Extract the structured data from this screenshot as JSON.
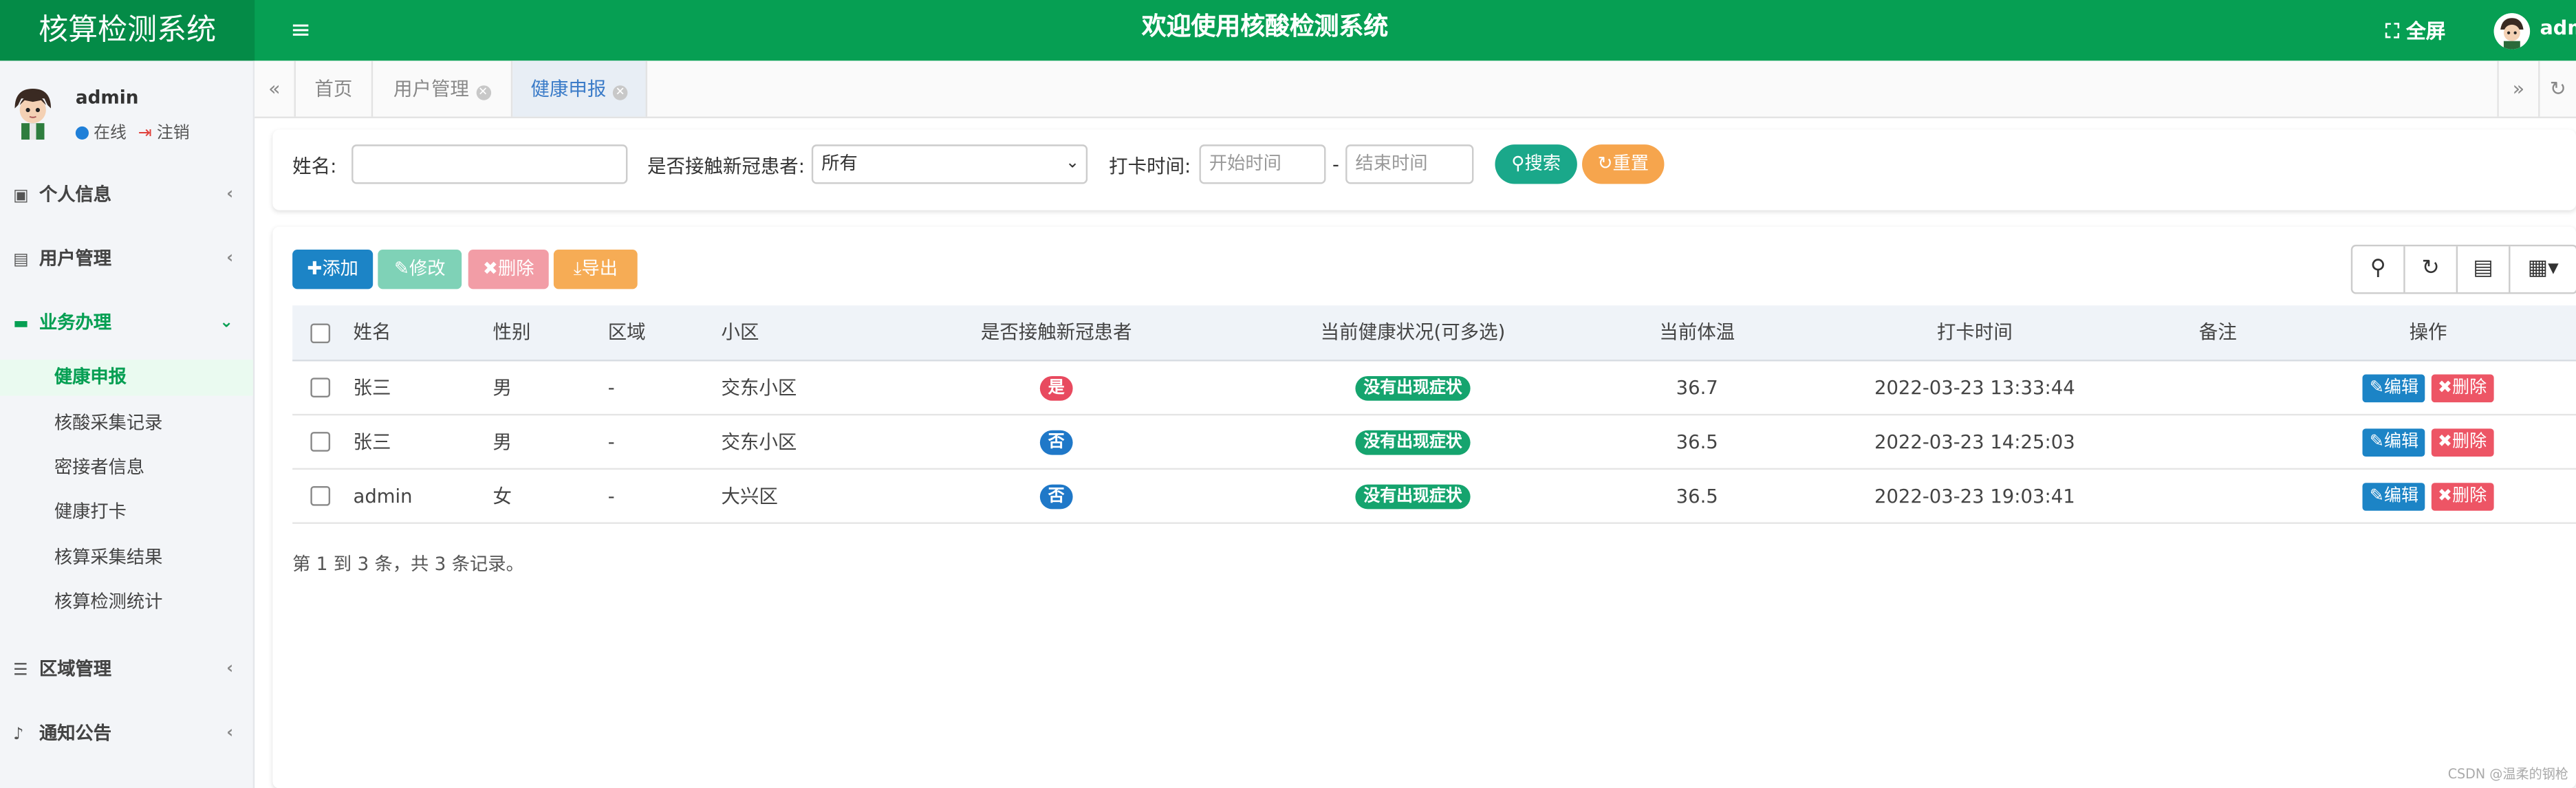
{
  "app": {
    "logo_text": "核算检测系统",
    "welcome_text": "欢迎使用核酸检测系统",
    "fullscreen_label": "全屏",
    "top_user": "admin",
    "menu_icon": "hamburger-icon",
    "colors": {
      "brand": "#069f53",
      "brand_dark": "#048b47"
    }
  },
  "sidebar": {
    "username": "admin",
    "status_online": "在线",
    "logout_label": "注销",
    "groups": [
      {
        "label": "个人信息",
        "icon": "id-card-icon"
      },
      {
        "label": "用户管理",
        "icon": "address-card-icon"
      },
      {
        "label": "业务办理",
        "icon": "coffee-cup-icon"
      },
      {
        "label": "区域管理",
        "icon": "server-icon"
      },
      {
        "label": "通知公告",
        "icon": "bell-icon"
      }
    ],
    "sub_items": [
      {
        "label": "健康申报"
      },
      {
        "label": "核酸采集记录"
      },
      {
        "label": "密接者信息"
      },
      {
        "label": "健康打卡"
      },
      {
        "label": "核算采集结果"
      },
      {
        "label": "核算检测统计"
      }
    ]
  },
  "tabs": [
    {
      "label": "首页"
    },
    {
      "label": "用户管理"
    },
    {
      "label": "健康申报"
    }
  ],
  "search": {
    "name_label": "姓名:",
    "name_value": "",
    "contact_label": "是否接触新冠患者:",
    "contact_value": "所有",
    "time_label": "打卡时间:",
    "start_placeholder": "开始时间",
    "separator": "-",
    "end_placeholder": "结束时间",
    "search_button": "搜索",
    "reset_button": "重置"
  },
  "toolbar": {
    "add": "添加",
    "edit": "修改",
    "delete": "删除",
    "export": "导出",
    "tools": [
      "search-icon",
      "refresh-icon",
      "columns-icon",
      "grid-icon"
    ]
  },
  "table": {
    "headers": [
      "姓名",
      "性别",
      "区域",
      "小区",
      "是否接触新冠患者",
      "当前健康状况(可多选)",
      "当前体温",
      "打卡时间",
      "备注",
      "操作"
    ],
    "rows": [
      {
        "name": "张三",
        "gender": "男",
        "area": "-",
        "community": "交东小区",
        "contact": "是",
        "health": "没有出现症状",
        "temp": "36.7",
        "time": "2022-03-23 13:33:44",
        "remark": ""
      },
      {
        "name": "张三",
        "gender": "男",
        "area": "-",
        "community": "交东小区",
        "contact": "否",
        "health": "没有出现症状",
        "temp": "36.5",
        "time": "2022-03-23 14:25:03",
        "remark": ""
      },
      {
        "name": "admin",
        "gender": "女",
        "area": "-",
        "community": "大兴区",
        "contact": "否",
        "health": "没有出现症状",
        "temp": "36.5",
        "time": "2022-03-23 19:03:41",
        "remark": ""
      }
    ],
    "edit_label": "编辑",
    "delete_label": "删除",
    "colors": {
      "yes": "#e84a5f",
      "no": "#1f78c8",
      "health": "#15a46e"
    }
  },
  "pager_text": "第 1 到 3 条，共 3 条记录。",
  "watermark": "CSDN @温柔的钢枪"
}
